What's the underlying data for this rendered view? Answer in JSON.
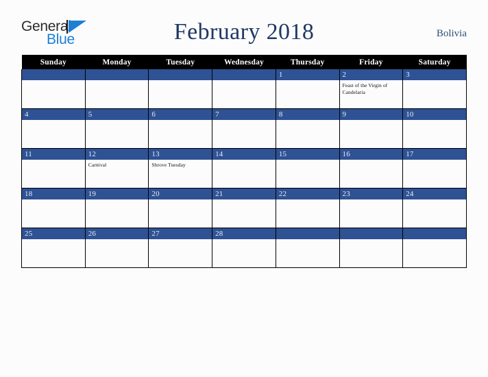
{
  "brand": {
    "name_part1": "General",
    "name_part2": "Blue",
    "mark": "triangle-logo-mark"
  },
  "header": {
    "title": "February 2018",
    "country": "Bolivia"
  },
  "colors": {
    "day_band_blue": "#2e5294",
    "header_row_black": "#000000",
    "title_navy": "#1f3864",
    "country_navy": "#2f5074",
    "brand_blue": "#1b7fd4",
    "page_background": "#fcfcfd"
  },
  "calendar": {
    "month": "February",
    "year": "2018",
    "weekday_headers": [
      "Sunday",
      "Monday",
      "Tuesday",
      "Wednesday",
      "Thursday",
      "Friday",
      "Saturday"
    ],
    "weeks": [
      [
        {
          "day": "",
          "events": []
        },
        {
          "day": "",
          "events": []
        },
        {
          "day": "",
          "events": []
        },
        {
          "day": "",
          "events": []
        },
        {
          "day": "1",
          "events": []
        },
        {
          "day": "2",
          "events": [
            "Feast of the Virgin of Candelaria"
          ]
        },
        {
          "day": "3",
          "events": []
        }
      ],
      [
        {
          "day": "4",
          "events": []
        },
        {
          "day": "5",
          "events": []
        },
        {
          "day": "6",
          "events": []
        },
        {
          "day": "7",
          "events": []
        },
        {
          "day": "8",
          "events": []
        },
        {
          "day": "9",
          "events": []
        },
        {
          "day": "10",
          "events": []
        }
      ],
      [
        {
          "day": "11",
          "events": []
        },
        {
          "day": "12",
          "events": [
            "Carnival"
          ]
        },
        {
          "day": "13",
          "events": [
            "Shrove Tuesday"
          ]
        },
        {
          "day": "14",
          "events": []
        },
        {
          "day": "15",
          "events": []
        },
        {
          "day": "16",
          "events": []
        },
        {
          "day": "17",
          "events": []
        }
      ],
      [
        {
          "day": "18",
          "events": []
        },
        {
          "day": "19",
          "events": []
        },
        {
          "day": "20",
          "events": []
        },
        {
          "day": "21",
          "events": []
        },
        {
          "day": "22",
          "events": []
        },
        {
          "day": "23",
          "events": []
        },
        {
          "day": "24",
          "events": []
        }
      ],
      [
        {
          "day": "25",
          "events": []
        },
        {
          "day": "26",
          "events": []
        },
        {
          "day": "27",
          "events": []
        },
        {
          "day": "28",
          "events": []
        },
        {
          "day": "",
          "events": []
        },
        {
          "day": "",
          "events": []
        },
        {
          "day": "",
          "events": []
        }
      ]
    ]
  }
}
